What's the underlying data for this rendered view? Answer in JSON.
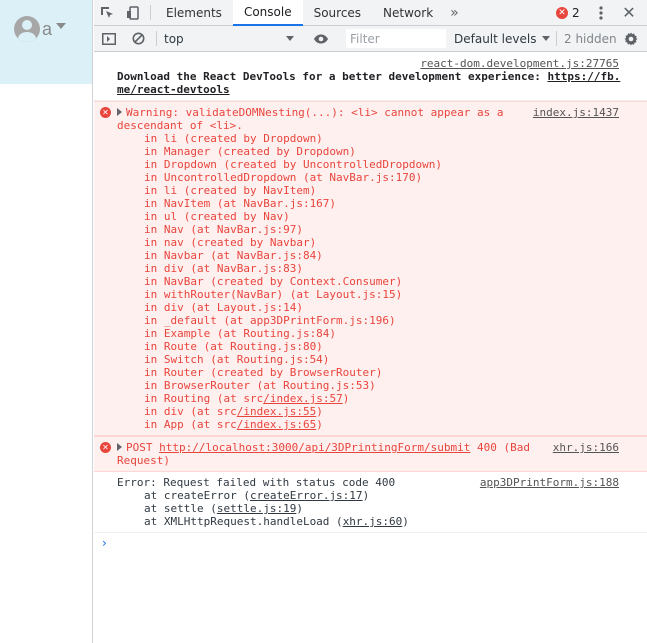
{
  "page": {
    "user_name": "a"
  },
  "devtools": {
    "tabs": [
      "Elements",
      "Console",
      "Sources",
      "Network"
    ],
    "active_tab": "Console",
    "more_tabs_icon": "»",
    "error_count": "2",
    "filterbar": {
      "context": "top",
      "filter_placeholder": "Filter",
      "levels": "Default levels",
      "hidden": "2 hidden"
    },
    "colors": {
      "accent": "#1a73e8",
      "error": "#e8453c",
      "error_bg": "#fff0f0",
      "navbar_bg": "#dcf0f8"
    }
  },
  "console": {
    "messages": [
      {
        "level": "log",
        "source": "react-dom.development.js:27765",
        "text_1": "Download the React DevTools for a better development experience: ",
        "link_1": "https://fb.",
        "link_2": "me/react-devtools"
      },
      {
        "level": "error",
        "source": "index.js:1437",
        "text_1": "Warning: validateDOMNesting(...): <li> cannot appear as a",
        "text_2": "descendant of <li>.",
        "stack": [
          "in li (created by Dropdown)",
          "in Manager (created by Dropdown)",
          "in Dropdown (created by UncontrolledDropdown)",
          "in UncontrolledDropdown (at NavBar.js:170)",
          "in li (created by NavItem)",
          "in NavItem (at NavBar.js:167)",
          "in ul (created by Nav)",
          "in Nav (at NavBar.js:97)",
          "in nav (created by Navbar)",
          "in Navbar (at NavBar.js:84)",
          "in div (at NavBar.js:83)",
          "in NavBar (created by Context.Consumer)",
          "in withRouter(NavBar) (at Layout.js:15)",
          "in div (at Layout.js:14)",
          "in _default (at app3DPrintForm.js:196)",
          "in Example (at Routing.js:84)",
          "in Route (at Routing.js:80)",
          "in Switch (at Routing.js:54)",
          "in Router (created by BrowserRouter)",
          "in BrowserRouter (at Routing.js:53)"
        ],
        "stack_linked": [
          {
            "pre": "in Routing (at src",
            "link": "/index.js:57",
            "post": ")"
          },
          {
            "pre": "in div (at src",
            "link": "/index.js:55",
            "post": ")"
          },
          {
            "pre": "in App (at src",
            "link": "/index.js:65",
            "post": ")"
          }
        ]
      },
      {
        "level": "error",
        "source": "xhr.js:166",
        "method": "POST",
        "url": "http://localhost:3000/api/3DPrintingForm/submit",
        "status": "400 (Bad",
        "status_2": "Request)"
      },
      {
        "level": "log",
        "source": "app3DPrintForm.js:188",
        "text_1": "Error: Request failed with status code 400",
        "frames": [
          {
            "pre": "at createError (",
            "link": "createError.js:17",
            "post": ")"
          },
          {
            "pre": "at settle (",
            "link": "settle.js:19",
            "post": ")"
          },
          {
            "pre": "at XMLHttpRequest.handleLoad (",
            "link": "xhr.js:60",
            "post": ")"
          }
        ]
      }
    ],
    "prompt_symbol": "›"
  }
}
